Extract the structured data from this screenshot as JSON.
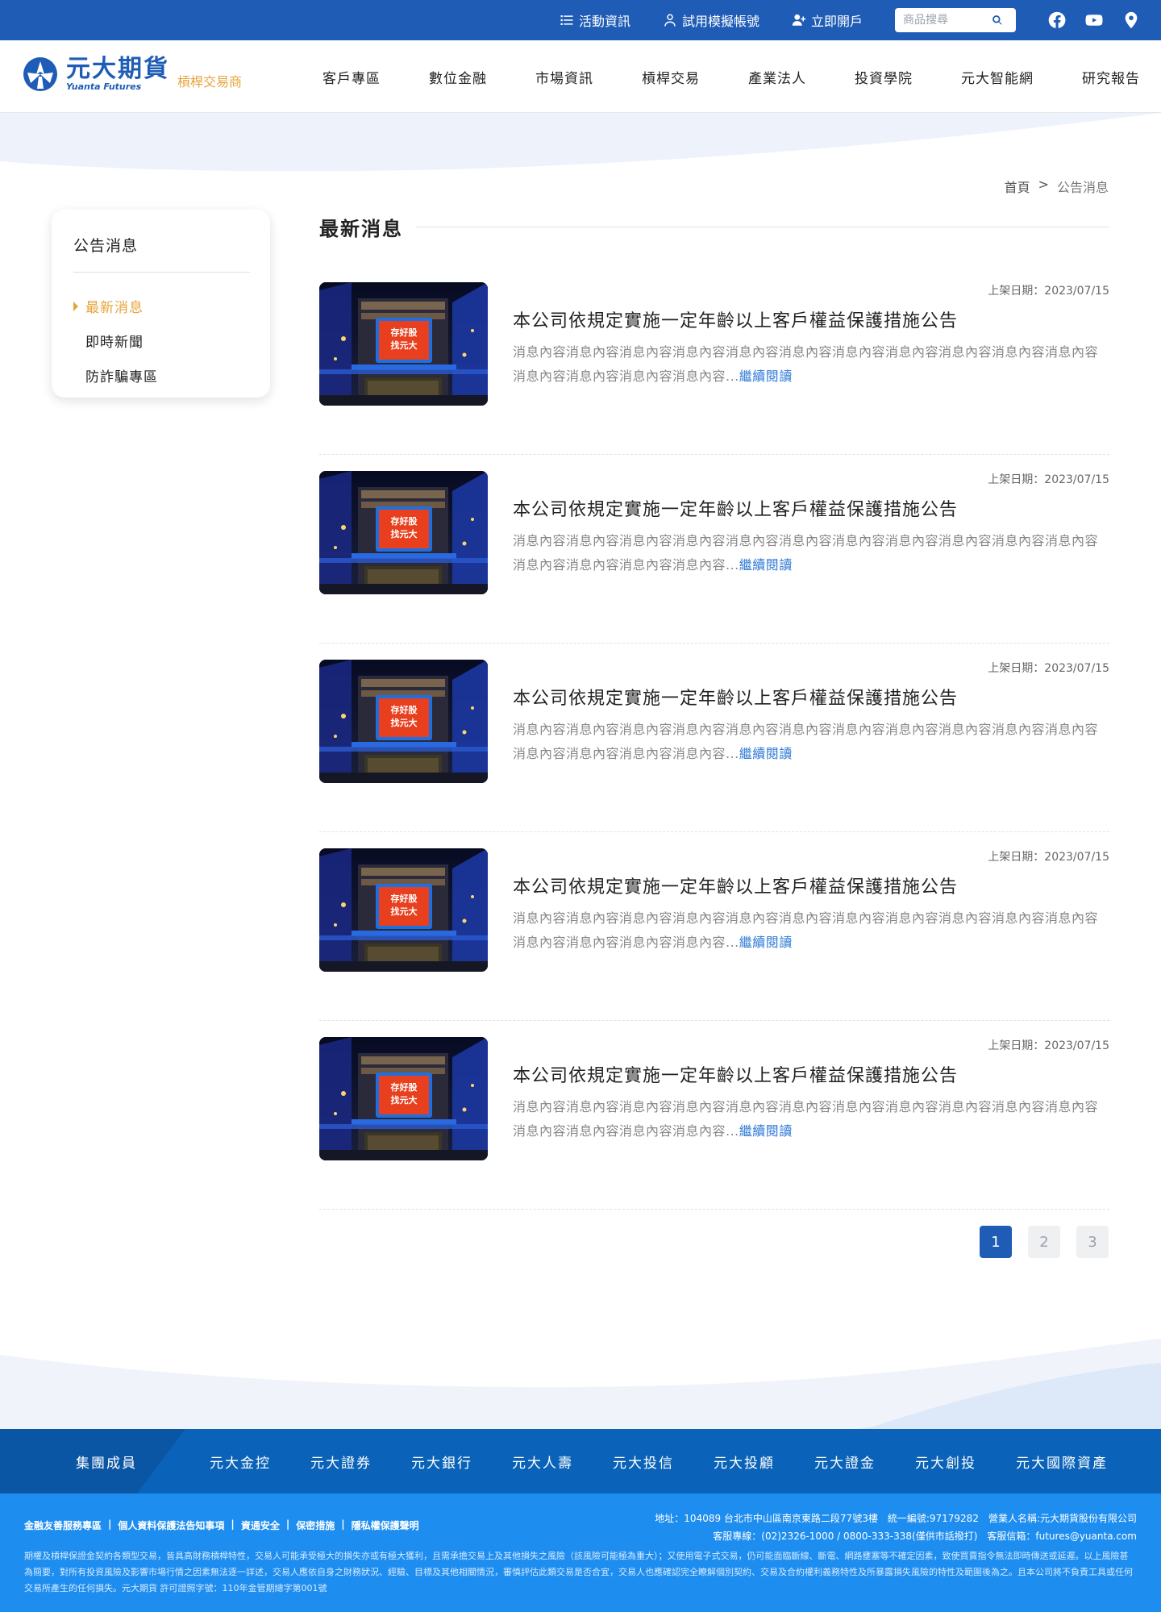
{
  "topbar": {
    "links": [
      {
        "label": "活動資訊",
        "icon": "list-icon"
      },
      {
        "label": "試用模擬帳號",
        "icon": "user-icon"
      },
      {
        "label": "立即開戶",
        "icon": "user-plus-icon"
      }
    ],
    "search_placeholder": "商品搜尋",
    "social": [
      "facebook-icon",
      "youtube-icon",
      "location-pin-icon"
    ]
  },
  "brand": {
    "name_cn": "元大期貨",
    "name_en": "Yuanta Futures",
    "subtitle": "槓桿交易商",
    "primary_color": "#1f5cb5",
    "accent_color": "#e8a33b"
  },
  "nav": [
    "客戶專區",
    "數位金融",
    "市場資訊",
    "槓桿交易",
    "產業法人",
    "投資學院",
    "元大智能網",
    "研究報告"
  ],
  "breadcrumb": {
    "home": "首頁",
    "separator": ">",
    "current": "公告消息"
  },
  "sidebar": {
    "title": "公告消息",
    "items": [
      {
        "label": "最新消息",
        "active": true
      },
      {
        "label": "即時新聞",
        "active": false
      },
      {
        "label": "防詐騙專區",
        "active": false
      }
    ]
  },
  "main": {
    "title": "最新消息",
    "news": [
      {
        "date": "上架日期：2023/07/15",
        "title": "本公司依規定實施一定年齡以上客戶權益保護措施公告",
        "desc": "消息內容消息內容消息內容消息內容消息內容消息內容消息內容消息內容消息內容消息內容消息內容消息內容消息內容消息內容消息內容...",
        "more": "繼續閱讀"
      },
      {
        "date": "上架日期：2023/07/15",
        "title": "本公司依規定實施一定年齡以上客戶權益保護措施公告",
        "desc": "消息內容消息內容消息內容消息內容消息內容消息內容消息內容消息內容消息內容消息內容消息內容消息內容消息內容消息內容消息內容...",
        "more": "繼續閱讀"
      },
      {
        "date": "上架日期：2023/07/15",
        "title": "本公司依規定實施一定年齡以上客戶權益保護措施公告",
        "desc": "消息內容消息內容消息內容消息內容消息內容消息內容消息內容消息內容消息內容消息內容消息內容消息內容消息內容消息內容消息內容...",
        "more": "繼續閱讀"
      },
      {
        "date": "上架日期：2023/07/15",
        "title": "本公司依規定實施一定年齡以上客戶權益保護措施公告",
        "desc": "消息內容消息內容消息內容消息內容消息內容消息內容消息內容消息內容消息內容消息內容消息內容消息內容消息內容消息內容消息內容...",
        "more": "繼續閱讀"
      },
      {
        "date": "上架日期：2023/07/15",
        "title": "本公司依規定實施一定年齡以上客戶權益保護措施公告",
        "desc": "消息內容消息內容消息內容消息內容消息內容消息內容消息內容消息內容消息內容消息內容消息內容消息內容消息內容消息內容消息內容...",
        "more": "繼續閱讀"
      }
    ],
    "thumb_sign": {
      "line1": "存好股",
      "line2": "找元大"
    }
  },
  "pagination": {
    "pages": [
      "1",
      "2",
      "3"
    ],
    "current": "1"
  },
  "footer": {
    "group_label": "集團成員",
    "group_members": [
      "元大金控",
      "元大證券",
      "元大銀行",
      "元大人壽",
      "元大投信",
      "元大投顧",
      "元大證金",
      "元大創投",
      "元大國際資產"
    ],
    "links": [
      "金融友善服務專區",
      "個人資料保護法告知事項",
      "資通安全",
      "保密措施",
      "隱私權保護聲明"
    ],
    "address_line": "地址：104089 台北市中山區南京東路二段77號3樓　統一編號:97179282　營業人名稱:元大期貨股份有限公司",
    "contact_line": "客服專線：(02)2326-1000 / 0800-333-338(僅供市話撥打)　客服信箱：futures@yuanta.com",
    "disclaimer": "期權及槓桿保證金契約各類型交易，皆具高財務槓桿特性，交易人可能承受極大的損失亦或有極大獲利，且需承擔交易上及其他損失之風險（該風險可能極為重大）；又使用電子式交易，仍可能面臨斷線、斷電、網路壅塞等不確定因素，致使買賣指令無法即時傳送或延遲。以上風險甚為簡要，對所有投資風險及影響市場行情之因素無法逐一詳述，交易人應依自身之財務狀況、經驗、目標及其他相關情況，審慎評估此類交易是否合宜，交易人也應確認完全瞭解個別契約、交易及合約權利義務特性及所暴露損失風險的特性及範圍後為之。且本公司將不負責工具或任何交易所產生的任何損失。元大期貨 許可證照字號：110年金管期總字第001號"
  }
}
